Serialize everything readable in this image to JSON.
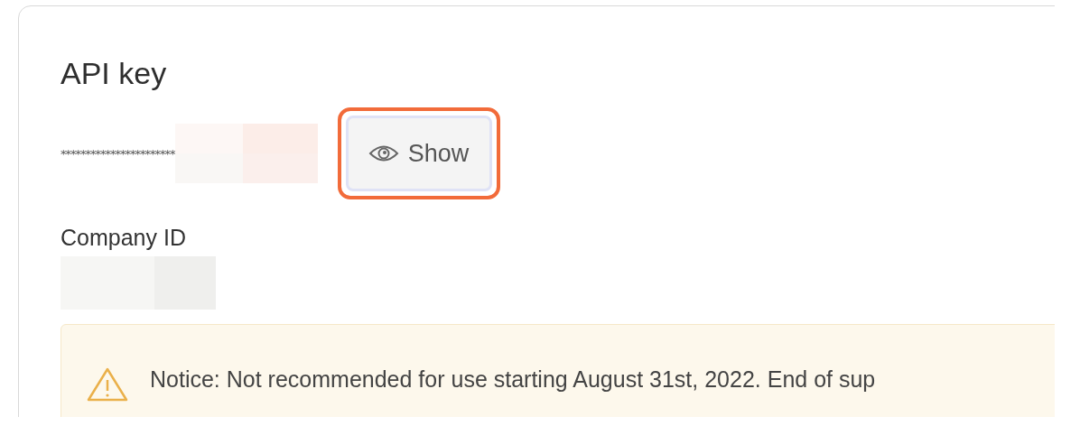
{
  "api_key": {
    "title": "API key",
    "masked_value": "***********************",
    "button": {
      "label": "Show",
      "highlighted": true
    }
  },
  "company_id": {
    "label": "Company ID"
  },
  "notice": {
    "text": "Notice: Not recommended for use starting August 31st, 2022. End of sup"
  }
}
